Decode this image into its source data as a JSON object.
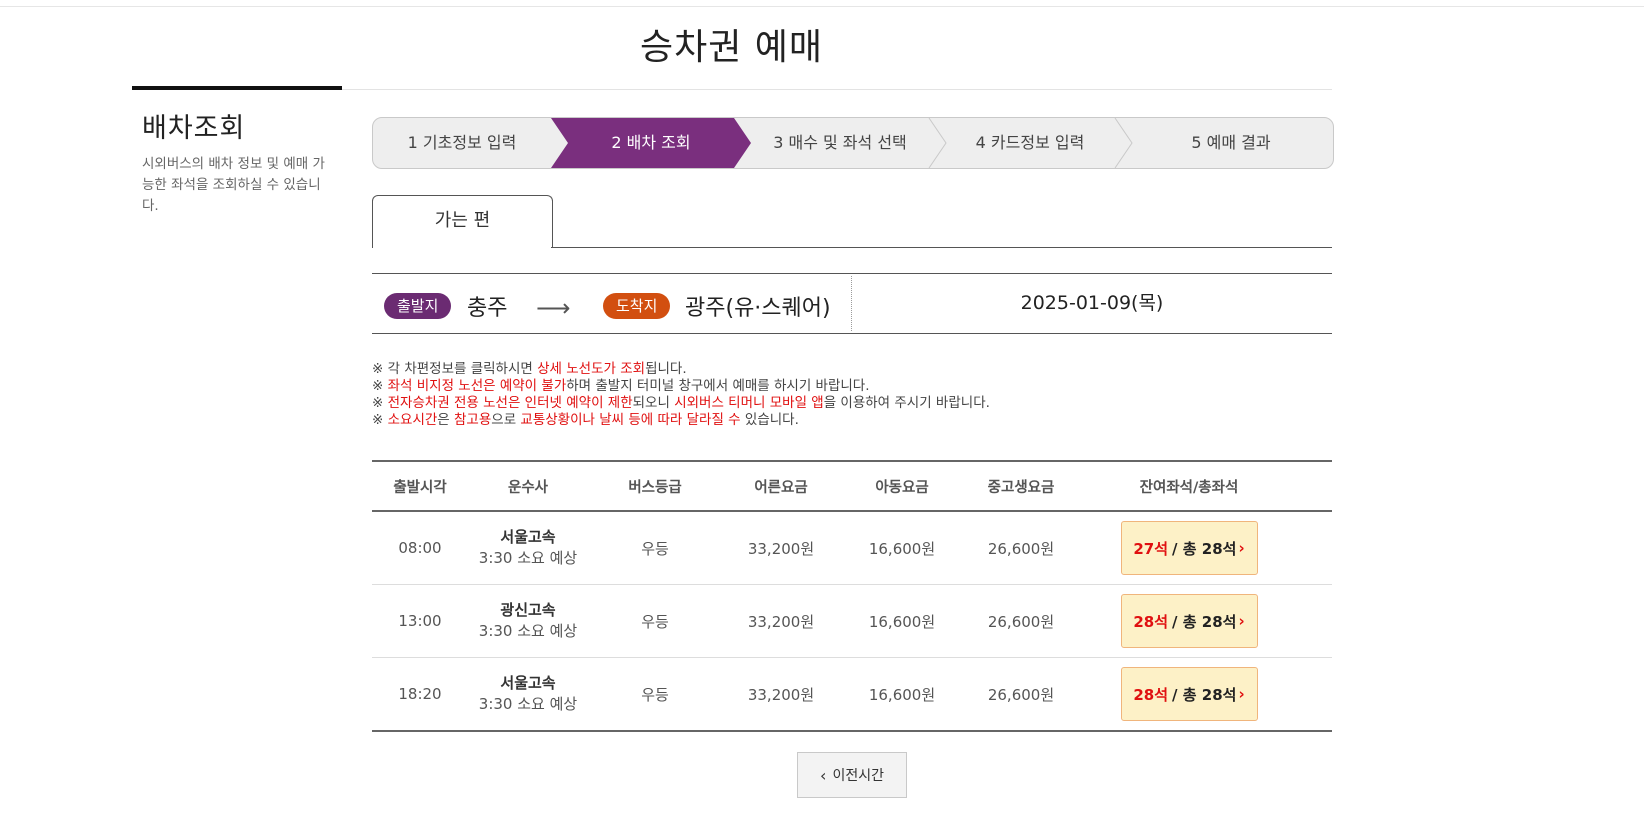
{
  "page": {
    "title": "승차권 예매"
  },
  "sidebar": {
    "title": "배차조회",
    "desc": "시외버스의 배차 정보 및 예매 가능한 좌석을 조회하실 수 있습니다."
  },
  "steps": [
    {
      "label": "1 기초정보 입력"
    },
    {
      "label": "2 배차 조회"
    },
    {
      "label": "3 매수 및 좌석 선택"
    },
    {
      "label": "4 카드정보 입력"
    },
    {
      "label": "5 예매 결과"
    }
  ],
  "tab": {
    "label": "가는 편"
  },
  "route": {
    "dep_badge": "출발지",
    "dep_city": "충주",
    "arrow": "⟶",
    "arr_badge": "도착지",
    "arr_city": "광주(유·스퀘어)",
    "date": "2025-01-09(목)"
  },
  "notices": [
    {
      "parts": [
        {
          "t": "※ 각 차편정보를 클릭하시면 ",
          "red": false
        },
        {
          "t": "상세 노선도가 조회",
          "red": true
        },
        {
          "t": "됩니다.",
          "red": false
        }
      ]
    },
    {
      "parts": [
        {
          "t": "※ ",
          "red": false
        },
        {
          "t": "좌석 비지정 노선은 예약이 불가",
          "red": true
        },
        {
          "t": "하며 출발지 터미널 창구에서 예매를 하시기 바랍니다.",
          "red": false
        }
      ]
    },
    {
      "parts": [
        {
          "t": "※ ",
          "red": false
        },
        {
          "t": "전자승차권 전용 노선은 인터넷 예약이 제한",
          "red": true
        },
        {
          "t": "되오니 ",
          "red": false
        },
        {
          "t": "시외버스 티머니 모바일 앱",
          "red": true
        },
        {
          "t": "을 이용하여 주시기 바랍니다.",
          "red": false
        }
      ]
    },
    {
      "parts": [
        {
          "t": "※ ",
          "red": false
        },
        {
          "t": "소요시간",
          "red": true
        },
        {
          "t": "은 ",
          "red": false
        },
        {
          "t": "참고용",
          "red": true
        },
        {
          "t": "으로 ",
          "red": false
        },
        {
          "t": "교통상황이나 날씨 등에 따라 달라질 수",
          "red": true
        },
        {
          "t": " 있습니다.",
          "red": false
        }
      ]
    }
  ],
  "table": {
    "headers": {
      "time": "출발시각",
      "company": "운수사",
      "grade": "버스등급",
      "adult": "어른요금",
      "child": "아동요금",
      "student": "중고생요금",
      "seats": "잔여좌석/총좌석"
    },
    "rows": [
      {
        "time": "08:00",
        "company": "서울고속",
        "duration": "3:30 소요 예상",
        "grade": "우등",
        "adult": "33,200원",
        "child": "16,600원",
        "student": "26,600원",
        "remaining": "27석",
        "total": "/ 총 28석"
      },
      {
        "time": "13:00",
        "company": "광신고속",
        "duration": "3:30 소요 예상",
        "grade": "우등",
        "adult": "33,200원",
        "child": "16,600원",
        "student": "26,600원",
        "remaining": "28석",
        "total": "/ 총 28석"
      },
      {
        "time": "18:20",
        "company": "서울고속",
        "duration": "3:30 소요 예상",
        "grade": "우등",
        "adult": "33,200원",
        "child": "16,600원",
        "student": "26,600원",
        "remaining": "28석",
        "total": "/ 총 28석"
      }
    ]
  },
  "prev_button": {
    "label": "이전시간"
  },
  "colors": {
    "accent": "#7a2f7e",
    "departure": "#6b2b72",
    "arrival": "#d24f10",
    "highlight": "#e01010",
    "seat_bg": "#fdf1c7"
  }
}
